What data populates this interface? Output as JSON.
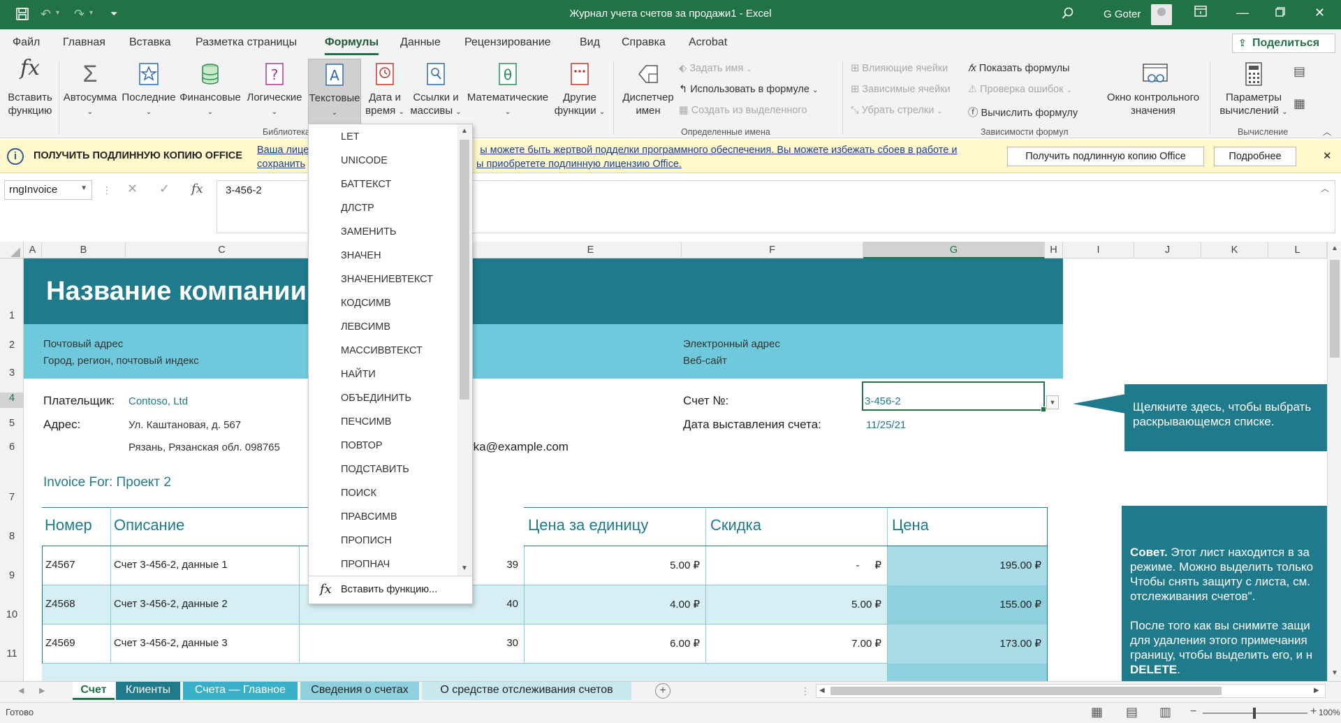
{
  "window": {
    "title": "Журнал учета счетов за продажи1  -  Excel",
    "user": "G Goter",
    "icons": [
      "save-icon",
      "undo-icon",
      "redo-icon",
      "customize-icon",
      "search-icon",
      "ribbon-display-icon",
      "minimize-icon",
      "maximize-icon",
      "close-icon"
    ]
  },
  "menu": {
    "tabs": [
      "Файл",
      "Главная",
      "Вставка",
      "Разметка страницы",
      "Формулы",
      "Данные",
      "Рецензирование",
      "Вид",
      "Справка",
      "Acrobat"
    ],
    "active": "Формулы",
    "share": "Поделиться"
  },
  "ribbon": {
    "library": {
      "insert_function": [
        "Вставить",
        "функцию"
      ],
      "autosum": "Автосумма",
      "recent": "Последние",
      "financial": "Финансовые",
      "logical": "Логические",
      "text": "Текстовые",
      "datetime": [
        "Дата и",
        "время"
      ],
      "lookup": [
        "Ссылки и",
        "массивы"
      ],
      "math": "Математические",
      "other": [
        "Другие",
        "функции"
      ],
      "group_label": "Библиотека"
    },
    "names": {
      "manager": [
        "Диспетчер",
        "имен"
      ],
      "define": "Задать имя",
      "use": "Использовать в формуле",
      "create": "Создать из выделенного",
      "group_label": "Определенные имена"
    },
    "audit": {
      "precedents": "Влияющие ячейки",
      "dependents": "Зависимые ячейки",
      "remove_arrows": "Убрать стрелки",
      "show_formulas": "Показать формулы",
      "error_check": "Проверка ошибок",
      "evaluate": "Вычислить формулу",
      "watch": [
        "Окно контрольного",
        "значения"
      ],
      "group_label": "Зависимости формул"
    },
    "calc": {
      "options": [
        "Параметры",
        "вычислений"
      ],
      "group_label": "Вычисление"
    }
  },
  "notice": {
    "heading": "ПОЛУЧИТЬ ПОДЛИННУЮ КОПИЮ OFFICE",
    "line1": "Ваша лице",
    "line1b": "ы можете быть жертвой подделки программного обеспечения. Вы можете избежать сбоев в работе и",
    "line2": "сохранить",
    "line2b": "ы приобретете подлинную лицензию Office.",
    "btn_get": "Получить подлинную копию Office",
    "btn_more": "Подробнее"
  },
  "formula_bar": {
    "name_box": "rngInvoice",
    "content": "3-456-2",
    "fx": "fx"
  },
  "columns": [
    "A",
    "B",
    "C",
    "E",
    "F",
    "G",
    "H",
    "I",
    "J",
    "K",
    "L"
  ],
  "rows": [
    "1",
    "2",
    "3",
    "4",
    "5",
    "6",
    "7",
    "8",
    "9",
    "10",
    "11"
  ],
  "sheet": {
    "company": "Название компании",
    "postal_label": "Почтовый адрес",
    "city_line": "Город, регион, почтовый индекс",
    "email_label": "Электронный адрес",
    "website": "Веб-сайт",
    "payer_label": "Плательщик:",
    "payer": "Contoso, Ltd",
    "address_label": "Адрес:",
    "address1": "Ул. Каштановая, д. 567",
    "address2": "Рязань, Рязанская обл. 098765",
    "email_partial": "rka@example.com",
    "invoice_no_label": "Счет №:",
    "invoice_no": "3-456-2",
    "invoice_date_label": "Дата выставления счета:",
    "invoice_date": "11/25/21",
    "invoice_for": "Invoice For: Проект 2",
    "callout": "Щелкните здесь, чтобы выбрать раскрывающемся списке.",
    "callout_lines": [
      "Щелкните здесь, чтобы выбрать",
      "раскрывающемся списке."
    ],
    "tip_lines": [
      [
        "Совет.",
        " Этот лист находится в за"
      ],
      [
        "",
        "режиме. Можно выделить только"
      ],
      [
        "",
        "Чтобы снять защиту с листа, см."
      ],
      [
        "",
        "отслеживания счетов\"."
      ],
      [
        "",
        ""
      ],
      [
        "",
        "После того как вы снимите защи"
      ],
      [
        "",
        "для удаления этого примечания"
      ],
      [
        "",
        "границу, чтобы выделить его, и н"
      ],
      [
        "DELETE",
        "."
      ]
    ]
  },
  "table": {
    "headers": [
      "Номер",
      "Описание",
      "Цена за единицу",
      "Скидка",
      "Цена"
    ],
    "rows": [
      {
        "num": "Z4567",
        "desc": "Счет 3-456-2, данные 1",
        "qty": "39",
        "unit": "5.00 ₽",
        "disc": "-",
        "disc_cur": "₽",
        "price": "195.00 ₽"
      },
      {
        "num": "Z4568",
        "desc": "Счет 3-456-2, данные 2",
        "qty": "40",
        "unit": "4.00 ₽",
        "disc": "5.00 ₽",
        "disc_cur": "",
        "price": "155.00 ₽"
      },
      {
        "num": "Z4569",
        "desc": "Счет 3-456-2, данные 3",
        "qty": "30",
        "unit": "6.00 ₽",
        "disc": "7.00 ₽",
        "disc_cur": "",
        "price": "173.00 ₽"
      }
    ]
  },
  "dropdown": {
    "items": [
      "LET",
      "UNICODE",
      "БАТТЕКСТ",
      "ДЛСТР",
      "ЗАМЕНИТЬ",
      "ЗНАЧЕН",
      "ЗНАЧЕНИЕВТЕКСТ",
      "КОДСИМВ",
      "ЛЕВСИМВ",
      "МАССИВВТЕКСТ",
      "НАЙТИ",
      "ОБЪЕДИНИТЬ",
      "ПЕЧСИМВ",
      "ПОВТОР",
      "ПОДСТАВИТЬ",
      "ПОИСК",
      "ПРАВСИМВ",
      "ПРОПИСН",
      "ПРОПНАЧ"
    ],
    "insert": "Вставить функцию..."
  },
  "sheet_tabs": [
    "Счет",
    "Клиенты",
    "Счета — Главное",
    "Сведения о счетах",
    "О средстве отслеживания счетов"
  ],
  "status": {
    "ready": "Готово",
    "zoom": "100%"
  },
  "colors": {
    "excel_green": "#217346",
    "teal_dark": "#1f7a8c",
    "teal_light": "#6ec9dc",
    "notice_bg": "#fff9cc"
  }
}
